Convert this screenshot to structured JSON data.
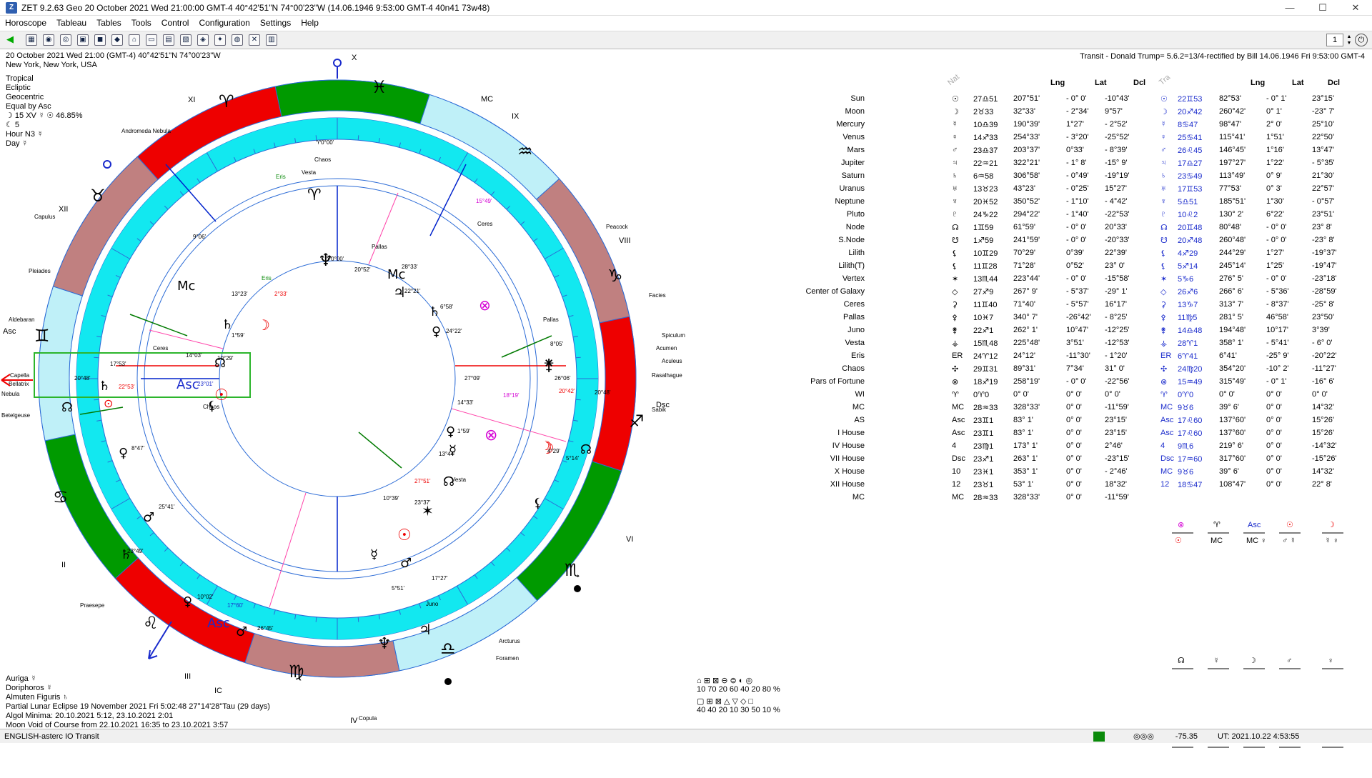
{
  "window": {
    "title": "ZET 9.2.63 Geo    20 October 2021   Wed   21:00:00 GMT-4 40°42'51\"N  74°00'23\"W  (14.06.1946   9:53:00 GMT-4 40n41 73w48)",
    "controls": [
      "—",
      "☐",
      "✕"
    ]
  },
  "menu": [
    "Horoscope",
    "Tableau",
    "Tables",
    "Tools",
    "Control",
    "Configuration",
    "Settings",
    "Help"
  ],
  "toolbar": {
    "buttons": [
      "◀",
      "▦",
      "◉",
      "◎",
      "▣",
      "◼",
      "◆",
      "⌂",
      "▭",
      "▤",
      "▧",
      "◈",
      "✦",
      "◍",
      "✕",
      "▥"
    ],
    "page_value": "1"
  },
  "chart_info": {
    "line1": "20 October 2021   Wed   21:00 (GMT-4) 40°42'51\"N  74°00'23\"W",
    "line2": "New York, New York, USA",
    "lines": [
      "Tropical",
      "Ecliptic",
      "Geocentric",
      "Equal by Asc",
      "☽  15 XV  ☿ ☉ 46.85%",
      "☾  5",
      "Hour N3  ☿",
      "Day  ☿"
    ]
  },
  "bottom_info": [
    "Auriga  ☿",
    "Doriphoros  ☿",
    "Almuten Figuris  ♄",
    "Partial Lunar Eclipse 19 November 2021 Fri   5:02:48 27°14'28\"Tau (29 days)",
    "Algol Minima: 20.10.2021  5:12,  23.10.2021  2:01",
    "Moon Void of Course from 22.10.2021 16:35 to 23.10.2021  3:57"
  ],
  "transit_header": "Transit - Donald Trump= 5.6.2=13/4-rectified by Bill 14.06.1946  Fri  9:53:00 GMT-4",
  "table": {
    "nat_label": "Nat",
    "tra_label": "Tra",
    "columns": [
      "Lng",
      "Lat",
      "Dcl",
      "Lng",
      "Lat",
      "Dcl"
    ],
    "rows": [
      {
        "name": "Sun",
        "sym": "☉",
        "pos": "27♎51",
        "lng": "207°51'",
        "lat": "-  0° 0'",
        "dcl": "-10°43'",
        "tsym": "☉",
        "tpos": "22♊53",
        "tlng": "82°53'",
        "tlat": "-  0° 1'",
        "tdcl": "23°15'"
      },
      {
        "name": "Moon",
        "sym": "☽",
        "pos": "2♉33",
        "lng": "32°33'",
        "lat": "- 2°34'",
        "dcl": "9°57'",
        "tsym": "☽",
        "tpos": "20♐42",
        "tlng": "260°42'",
        "tlat": "0° 1'",
        "tdcl": "-23° 7'"
      },
      {
        "name": "Mercury",
        "sym": "☿",
        "pos": "10♎39",
        "lng": "190°39'",
        "lat": "1°27'",
        "dcl": "- 2°52'",
        "tsym": "☿",
        "tpos": "8♋47",
        "tlng": "98°47'",
        "tlat": "2° 0'",
        "tdcl": "25°10'"
      },
      {
        "name": "Venus",
        "sym": "♀",
        "pos": "14♐33",
        "lng": "254°33'",
        "lat": "- 3°20'",
        "dcl": "-25°52'",
        "tsym": "♀",
        "tpos": "25♋41",
        "tlng": "115°41'",
        "tlat": "1°51'",
        "tdcl": "22°50'"
      },
      {
        "name": "Mars",
        "sym": "♂",
        "pos": "23♎37",
        "lng": "203°37'",
        "lat": "0°33'",
        "dcl": "- 8°39'",
        "tsym": "♂",
        "tpos": "26♌45",
        "tlng": "146°45'",
        "tlat": "1°16'",
        "tdcl": "13°47'"
      },
      {
        "name": "Jupiter",
        "sym": "♃",
        "pos": "22♒21",
        "lng": "322°21'",
        "lat": "- 1° 8'",
        "dcl": "-15° 9'",
        "tsym": "♃",
        "tpos": "17♎27",
        "tlng": "197°27'",
        "tlat": "1°22'",
        "tdcl": "- 5°35'"
      },
      {
        "name": "Saturn",
        "sym": "♄",
        "pos": "6♒58",
        "lng": "306°58'",
        "lat": "- 0°49'",
        "dcl": "-19°19'",
        "tsym": "♄",
        "tpos": "23♋49",
        "tlng": "113°49'",
        "tlat": "0° 9'",
        "tdcl": "21°30'"
      },
      {
        "name": "Uranus",
        "sym": "♅",
        "pos": "13♉23",
        "lng": "43°23'",
        "lat": "- 0°25'",
        "dcl": "15°27'",
        "tsym": "♅",
        "tpos": "17♊53",
        "tlng": "77°53'",
        "tlat": "0° 3'",
        "tdcl": "22°57'"
      },
      {
        "name": "Neptune",
        "sym": "♆",
        "pos": "20♓52",
        "lng": "350°52'",
        "lat": "- 1°10'",
        "dcl": "- 4°42'",
        "tsym": "♆",
        "tpos": "5♎51",
        "tlng": "185°51'",
        "tlat": "1°30'",
        "tdcl": "- 0°57'"
      },
      {
        "name": "Pluto",
        "sym": "♇",
        "pos": "24♑22",
        "lng": "294°22'",
        "lat": "- 1°40'",
        "dcl": "-22°53'",
        "tsym": "♇",
        "tpos": "10♌2",
        "tlng": "130° 2'",
        "tlat": "6°22'",
        "tdcl": "23°51'"
      },
      {
        "name": "Node",
        "sym": "☊",
        "pos": "1♊59",
        "lng": "61°59'",
        "lat": "-  0° 0'",
        "dcl": "20°33'",
        "tsym": "☊",
        "tpos": "20♊48",
        "tlng": "80°48'",
        "tlat": "-  0° 0'",
        "tdcl": "23° 8'"
      },
      {
        "name": "S.Node",
        "sym": "☋",
        "pos": "1♐59",
        "lng": "241°59'",
        "lat": "-  0° 0'",
        "dcl": "-20°33'",
        "tsym": "☋",
        "tpos": "20♐48",
        "tlng": "260°48'",
        "tlat": "-  0° 0'",
        "tdcl": "-23° 8'"
      },
      {
        "name": "Lilith",
        "sym": "⚸",
        "pos": "10♊29",
        "lng": "70°29'",
        "lat": "0°39'",
        "dcl": "22°39'",
        "tsym": "⚸",
        "tpos": "4♐29",
        "tlng": "244°29'",
        "tlat": "1°27'",
        "tdcl": "-19°37'"
      },
      {
        "name": "Lilith(T)",
        "sym": "⚸",
        "pos": "11♊28",
        "lng": "71°28'",
        "lat": "0°52'",
        "dcl": "23° 0'",
        "tsym": "⚸",
        "tpos": "5♐14",
        "tlng": "245°14'",
        "tlat": "1°25'",
        "tdcl": "-19°47'"
      },
      {
        "name": "Vertex",
        "sym": "✶",
        "pos": "13♏44",
        "lng": "223°44'",
        "lat": "-  0° 0'",
        "dcl": "-15°58'",
        "tsym": "✶",
        "tpos": "5♑6",
        "tlng": "276° 5'",
        "tlat": "-  0° 0'",
        "tdcl": "-23°18'"
      },
      {
        "name": "Center of Galaxy",
        "sym": "◇",
        "pos": "27♐9",
        "lng": "267° 9'",
        "lat": "- 5°37'",
        "dcl": "-29° 1'",
        "tsym": "◇",
        "tpos": "26♐6",
        "tlng": "266° 6'",
        "tlat": "- 5°36'",
        "tdcl": "-28°59'"
      },
      {
        "name": "Ceres",
        "sym": "⚳",
        "pos": "11♊40",
        "lng": "71°40'",
        "lat": "- 5°57'",
        "dcl": "16°17'",
        "tsym": "⚳",
        "tpos": "13♑7",
        "tlng": "313° 7'",
        "tlat": "- 8°37'",
        "tdcl": "-25° 8'"
      },
      {
        "name": "Pallas",
        "sym": "⚴",
        "pos": "10♓7",
        "lng": "340° 7'",
        "lat": "-26°42'",
        "dcl": "- 8°25'",
        "tsym": "⚴",
        "tpos": "11♍5",
        "tlng": "281° 5'",
        "tlat": "46°58'",
        "tdcl": "23°50'"
      },
      {
        "name": "Juno",
        "sym": "⚵",
        "pos": "22♐1",
        "lng": "262° 1'",
        "lat": "10°47'",
        "dcl": "-12°25'",
        "tsym": "⚵",
        "tpos": "14♎48",
        "tlng": "194°48'",
        "tlat": "10°17'",
        "tdcl": "3°39'"
      },
      {
        "name": "Vesta",
        "sym": "⚶",
        "pos": "15♏48",
        "lng": "225°48'",
        "lat": "3°51'",
        "dcl": "-12°53'",
        "tsym": "⚶",
        "tpos": "28♈1",
        "tlng": "358° 1'",
        "tlat": "- 5°41'",
        "tdcl": "- 6° 0'"
      },
      {
        "name": "Eris",
        "sym": "ER",
        "pos": "24♈12",
        "lng": "24°12'",
        "lat": "-11°30'",
        "dcl": "- 1°20'",
        "tsym": "ER",
        "tpos": "6♈41",
        "tlng": "6°41'",
        "tlat": "-25° 9'",
        "tdcl": "-20°22'"
      },
      {
        "name": "Chaos",
        "sym": "✣",
        "pos": "29♊31",
        "lng": "89°31'",
        "lat": "7°34'",
        "dcl": "31° 0'",
        "tsym": "✣",
        "tpos": "24♍20",
        "tlng": "354°20'",
        "tlat": "-10° 2'",
        "tdcl": "-11°27'"
      },
      {
        "name": "Pars of Fortune",
        "sym": "⊗",
        "pos": "18♐19",
        "lng": "258°19'",
        "lat": "-  0° 0'",
        "dcl": "-22°56'",
        "tsym": "⊗",
        "tpos": "15♒49",
        "tlng": "315°49'",
        "tlat": "-  0° 1'",
        "tdcl": "-16° 6'"
      },
      {
        "name": "WI",
        "sym": "♈",
        "pos": "0♈0",
        "lng": "0° 0'",
        "lat": "0° 0'",
        "dcl": "0° 0'",
        "tsym": "♈",
        "tpos": "0♈0",
        "tlng": "0° 0'",
        "tlat": "0° 0'",
        "tdcl": "0° 0'"
      },
      {
        "name": "MC",
        "sym": "MC",
        "pos": "28♒33",
        "lng": "328°33'",
        "lat": "0° 0'",
        "dcl": "-11°59'",
        "tsym": "MC",
        "tpos": "9♉6",
        "tlng": "39° 6'",
        "tlat": "0° 0'",
        "tdcl": "14°32'"
      },
      {
        "name": "AS",
        "sym": "Asc",
        "pos": "23♊1",
        "lng": "83° 1'",
        "lat": "0° 0'",
        "dcl": "23°15'",
        "tsym": "Asc",
        "tpos": "17♌60",
        "tlng": "137°60'",
        "tlat": "0° 0'",
        "tdcl": "15°26'"
      },
      {
        "name": "I House",
        "sym": "Asc",
        "pos": "23♊1",
        "lng": "83° 1'",
        "lat": "0° 0'",
        "dcl": "23°15'",
        "tsym": "Asc",
        "tpos": "17♌60",
        "tlng": "137°60'",
        "tlat": "0° 0'",
        "tdcl": "15°26'"
      },
      {
        "name": "IV House",
        "sym": "4",
        "pos": "23♍1",
        "lng": "173° 1'",
        "lat": "0° 0'",
        "dcl": "2°46'",
        "tsym": "4",
        "tpos": "9♏6",
        "tlng": "219° 6'",
        "tlat": "0° 0'",
        "tdcl": "-14°32'"
      },
      {
        "name": "VII House",
        "sym": "Dsc",
        "pos": "23♐1",
        "lng": "263° 1'",
        "lat": "0° 0'",
        "dcl": "-23°15'",
        "tsym": "Dsc",
        "tpos": "17♒60",
        "tlng": "317°60'",
        "tlat": "0° 0'",
        "tdcl": "-15°26'"
      },
      {
        "name": "X House",
        "sym": "10",
        "pos": "23♓1",
        "lng": "353° 1'",
        "lat": "0° 0'",
        "dcl": "- 2°46'",
        "tsym": "MC",
        "tpos": "9♉6",
        "tlng": "39° 6'",
        "tlat": "0° 0'",
        "tdcl": "14°32'"
      },
      {
        "name": "XII House",
        "sym": "12",
        "pos": "23♉1",
        "lng": "53° 1'",
        "lat": "0° 0'",
        "dcl": "18°32'",
        "tsym": "12",
        "tpos": "18♋47",
        "tlng": "108°47'",
        "tlat": "0° 0'",
        "tdcl": "22° 8'"
      },
      {
        "name": "MC",
        "sym": "MC",
        "pos": "28♒33",
        "lng": "328°33'",
        "lat": "0° 0'",
        "dcl": "-11°59'",
        "tsym": "",
        "tpos": "",
        "tlng": "",
        "tlat": "",
        "tdcl": ""
      }
    ]
  },
  "legend": {
    "row1_symbols": "⌂ ⊞ ⊠   ⊖ ⊜ ◐ ◎",
    "row1_values": "10  70  20      60  40  20  80 %",
    "row2_symbols": "▢ ⊞ ⊠   △ ▽ ◇ □",
    "row2_values": "40  40  20      10  30  50  10 %"
  },
  "status": {
    "left": "ENGLISH-asterc IO Transit",
    "value": "-75.35",
    "ut": "UT: 2021.10.22  4:53:55"
  },
  "colors": {
    "cyan": "#12e8f0",
    "red": "#ee0000",
    "green": "#009a00",
    "brown": "#c08080",
    "lightcyan": "#bff0f8",
    "asc_box": "#2cb52c"
  }
}
